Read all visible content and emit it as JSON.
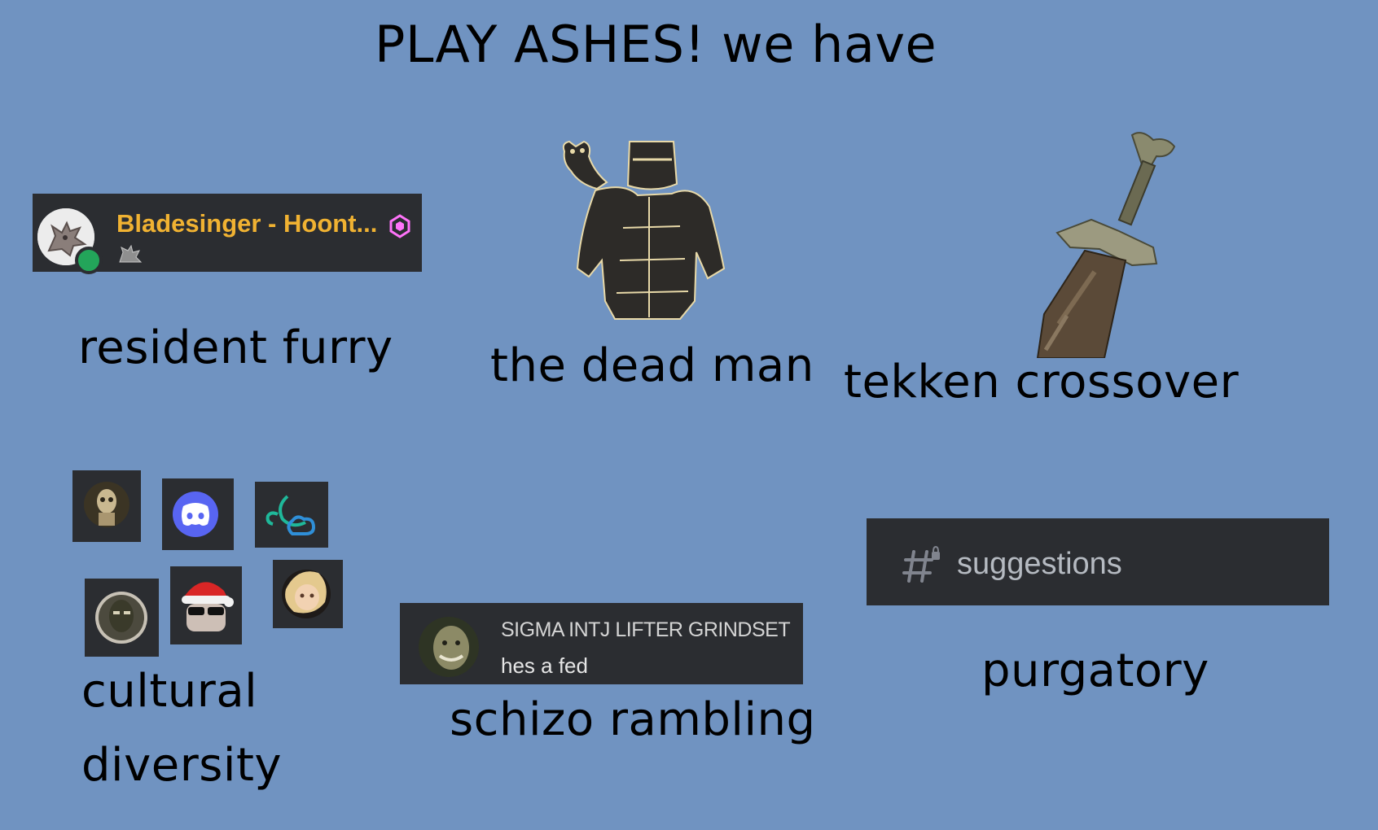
{
  "title": "PLAY ASHES! we have",
  "captions": {
    "resident_furry": "resident furry",
    "dead_man": "the dead man",
    "tekken": "tekken crossover",
    "cultural": "cultural",
    "diversity": "diversity",
    "schizo": "schizo rambling",
    "purgatory": "purgatory"
  },
  "user_card": {
    "username": "Bladesinger - Hoont...",
    "status": "online",
    "status_color": "#23a55a",
    "name_color": "#f0b232",
    "badge_icon": "server-boost-icon"
  },
  "message_card": {
    "username": "SIGMA INTJ LIFTER GRINDSET",
    "text": "hes a fed"
  },
  "channel_card": {
    "icon": "locked-channel-hash-icon",
    "name": "suggestions"
  },
  "colors": {
    "background": "#7093c1",
    "card": "#2b2d31",
    "discord_blurple": "#5865f2",
    "boost_pink": "#ff73fa"
  }
}
